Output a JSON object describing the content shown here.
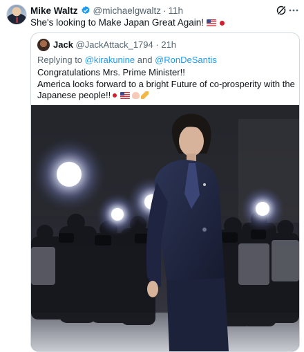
{
  "tweet": {
    "author_name": "Mike Waltz",
    "handle": "@michaelgwaltz",
    "separator": "·",
    "time": "11h",
    "text": "She's looking to Make Japan Great Again!"
  },
  "quoted": {
    "author_name": "Jack",
    "handle": "@JackAttack_1794",
    "separator": "·",
    "time": "21h",
    "reply_prefix": "Replying to",
    "reply_mention_1": "@kirakunine",
    "reply_and": "and",
    "reply_mention_2": "@RonDeSantis",
    "line1": "Congratulations Mrs. Prime Minister!!",
    "line2": "America looks forward to a bright Future of co-prosperity with the",
    "line3": "Japanese people!!"
  },
  "icons": {
    "verified": "verified-badge-icon",
    "grok": "grok-icon",
    "more": "more-icon"
  },
  "colors": {
    "link": "#1d9bf0",
    "verified": "#1d9bf0",
    "muted": "#536471"
  }
}
